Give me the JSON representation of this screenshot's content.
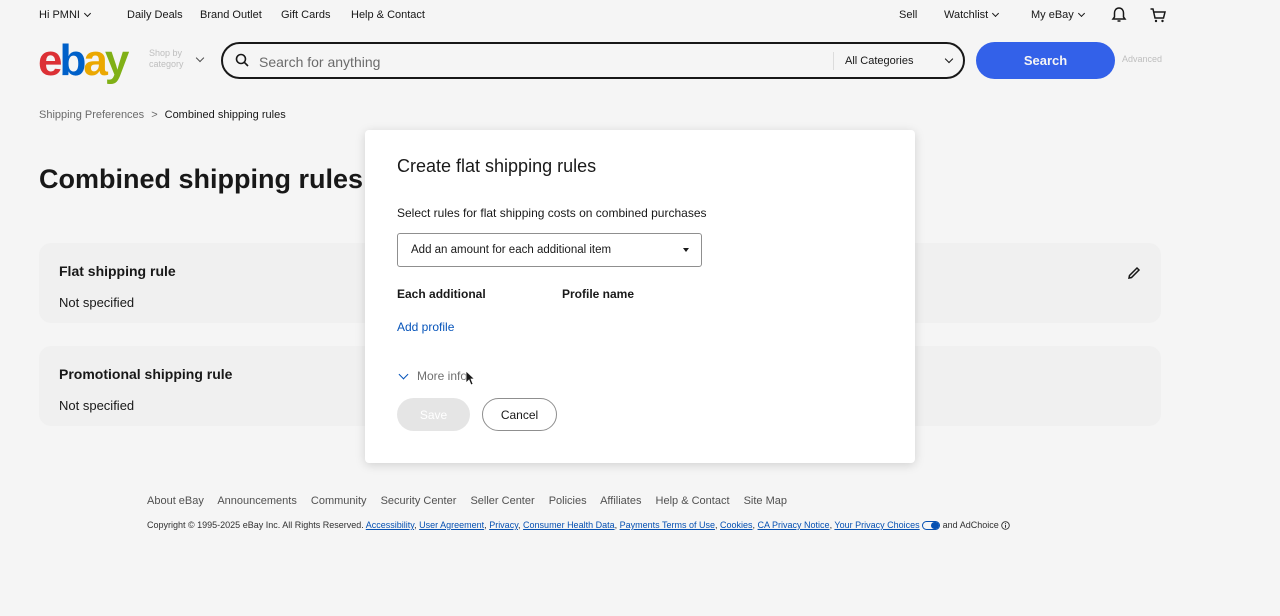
{
  "topbar": {
    "greeting": "Hi PMNI",
    "daily_deals": "Daily Deals",
    "brand_outlet": "Brand Outlet",
    "gift_cards": "Gift Cards",
    "help_contact": "Help & Contact",
    "sell": "Sell",
    "watchlist": "Watchlist",
    "my_ebay": "My eBay",
    "icons": [
      "bell-icon",
      "cart-icon"
    ]
  },
  "header": {
    "logo": "ebay",
    "shop_by_category": "Shop by category",
    "search_placeholder": "Search for anything",
    "category_selected": "All Categories",
    "search_button": "Search",
    "advanced": "Advanced"
  },
  "breadcrumb": {
    "parent": "Shipping Preferences",
    "separator": ">",
    "current": "Combined shipping rules"
  },
  "page": {
    "title": "Combined shipping rules",
    "rules": [
      {
        "title": "Flat shipping rule",
        "value": "Not specified"
      },
      {
        "title": "Promotional shipping rule",
        "value": "Not specified"
      }
    ]
  },
  "modal": {
    "title": "Create flat shipping rules",
    "subtitle": "Select rules for flat shipping costs on combined purchases",
    "select_value": "Add an amount for each additional item",
    "col_each_additional": "Each additional",
    "col_profile_name": "Profile name",
    "add_profile": "Add profile",
    "more_info": "More info",
    "save": "Save",
    "cancel": "Cancel"
  },
  "footer": {
    "links": [
      "About eBay",
      "Announcements",
      "Community",
      "Security Center",
      "Seller Center",
      "Policies",
      "Affiliates",
      "Help & Contact",
      "Site Map"
    ],
    "copyright_prefix": "Copyright © 1995-2025 eBay Inc. All Rights Reserved.",
    "legal_links": [
      "Accessibility",
      "User Agreement",
      "Privacy",
      "Consumer Health Data",
      "Payments Terms of Use",
      "Cookies",
      "CA Privacy Notice",
      "Your Privacy Choices"
    ],
    "and_text": "and",
    "adchoice": "AdChoice"
  },
  "colors": {
    "ebay_red": "#e53238",
    "ebay_blue": "#0064d2",
    "ebay_yellow": "#f5af02",
    "ebay_green": "#86b817",
    "primary_button": "#3665f3",
    "link": "#0654ba"
  }
}
